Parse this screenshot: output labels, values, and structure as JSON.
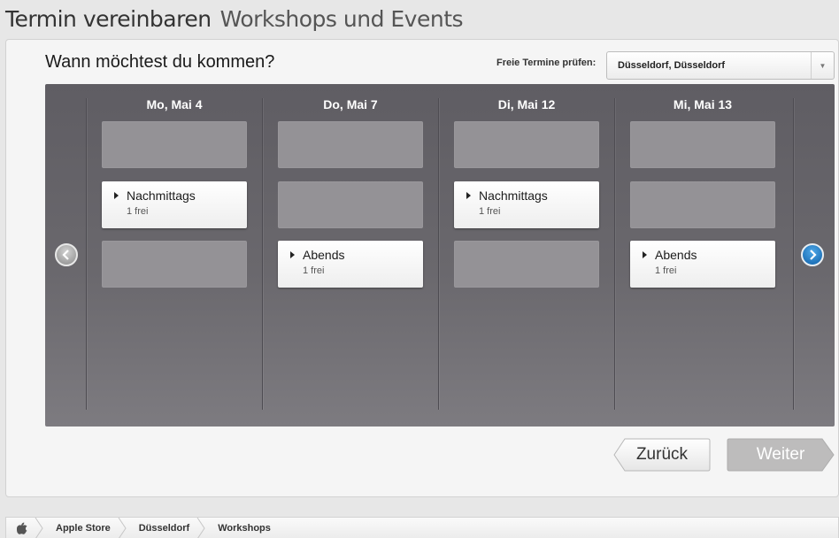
{
  "header": {
    "title": "Termin vereinbaren",
    "subtitle": "Workshops und Events"
  },
  "booking": {
    "question": "Wann möchtest du kommen?",
    "store_label": "Freie Termine prüfen:",
    "store_value": "Düsseldorf, Düsseldorf"
  },
  "calendar": {
    "days": [
      {
        "label": "Mo, Mai 4",
        "slots": [
          {
            "available": false,
            "label": "",
            "count": ""
          },
          {
            "available": true,
            "label": "Nachmittags",
            "count": "1 frei"
          },
          {
            "available": false,
            "label": "",
            "count": ""
          }
        ]
      },
      {
        "label": "Do, Mai 7",
        "slots": [
          {
            "available": false,
            "label": "",
            "count": ""
          },
          {
            "available": false,
            "label": "",
            "count": ""
          },
          {
            "available": true,
            "label": "Abends",
            "count": "1 frei"
          }
        ]
      },
      {
        "label": "Di, Mai 12",
        "slots": [
          {
            "available": false,
            "label": "",
            "count": ""
          },
          {
            "available": true,
            "label": "Nachmittags",
            "count": "1 frei"
          },
          {
            "available": false,
            "label": "",
            "count": ""
          }
        ]
      },
      {
        "label": "Mi, Mai 13",
        "slots": [
          {
            "available": false,
            "label": "",
            "count": ""
          },
          {
            "available": false,
            "label": "",
            "count": ""
          },
          {
            "available": true,
            "label": "Abends",
            "count": "1 frei"
          }
        ]
      }
    ]
  },
  "actions": {
    "back_label": "Zurück",
    "next_label": "Weiter"
  },
  "breadcrumb": {
    "items": [
      "Apple Store",
      "Düsseldorf",
      "Workshops"
    ]
  },
  "icons": {
    "home": "apple-logo-icon",
    "prev": "chevron-left-icon",
    "next": "chevron-right-icon",
    "dropdown": "chevron-down-icon",
    "slot": "triangle-right-icon"
  },
  "colors": {
    "calendar_bg": "#646268",
    "slot_empty": "#949296",
    "next_button": "#1f78c8"
  }
}
